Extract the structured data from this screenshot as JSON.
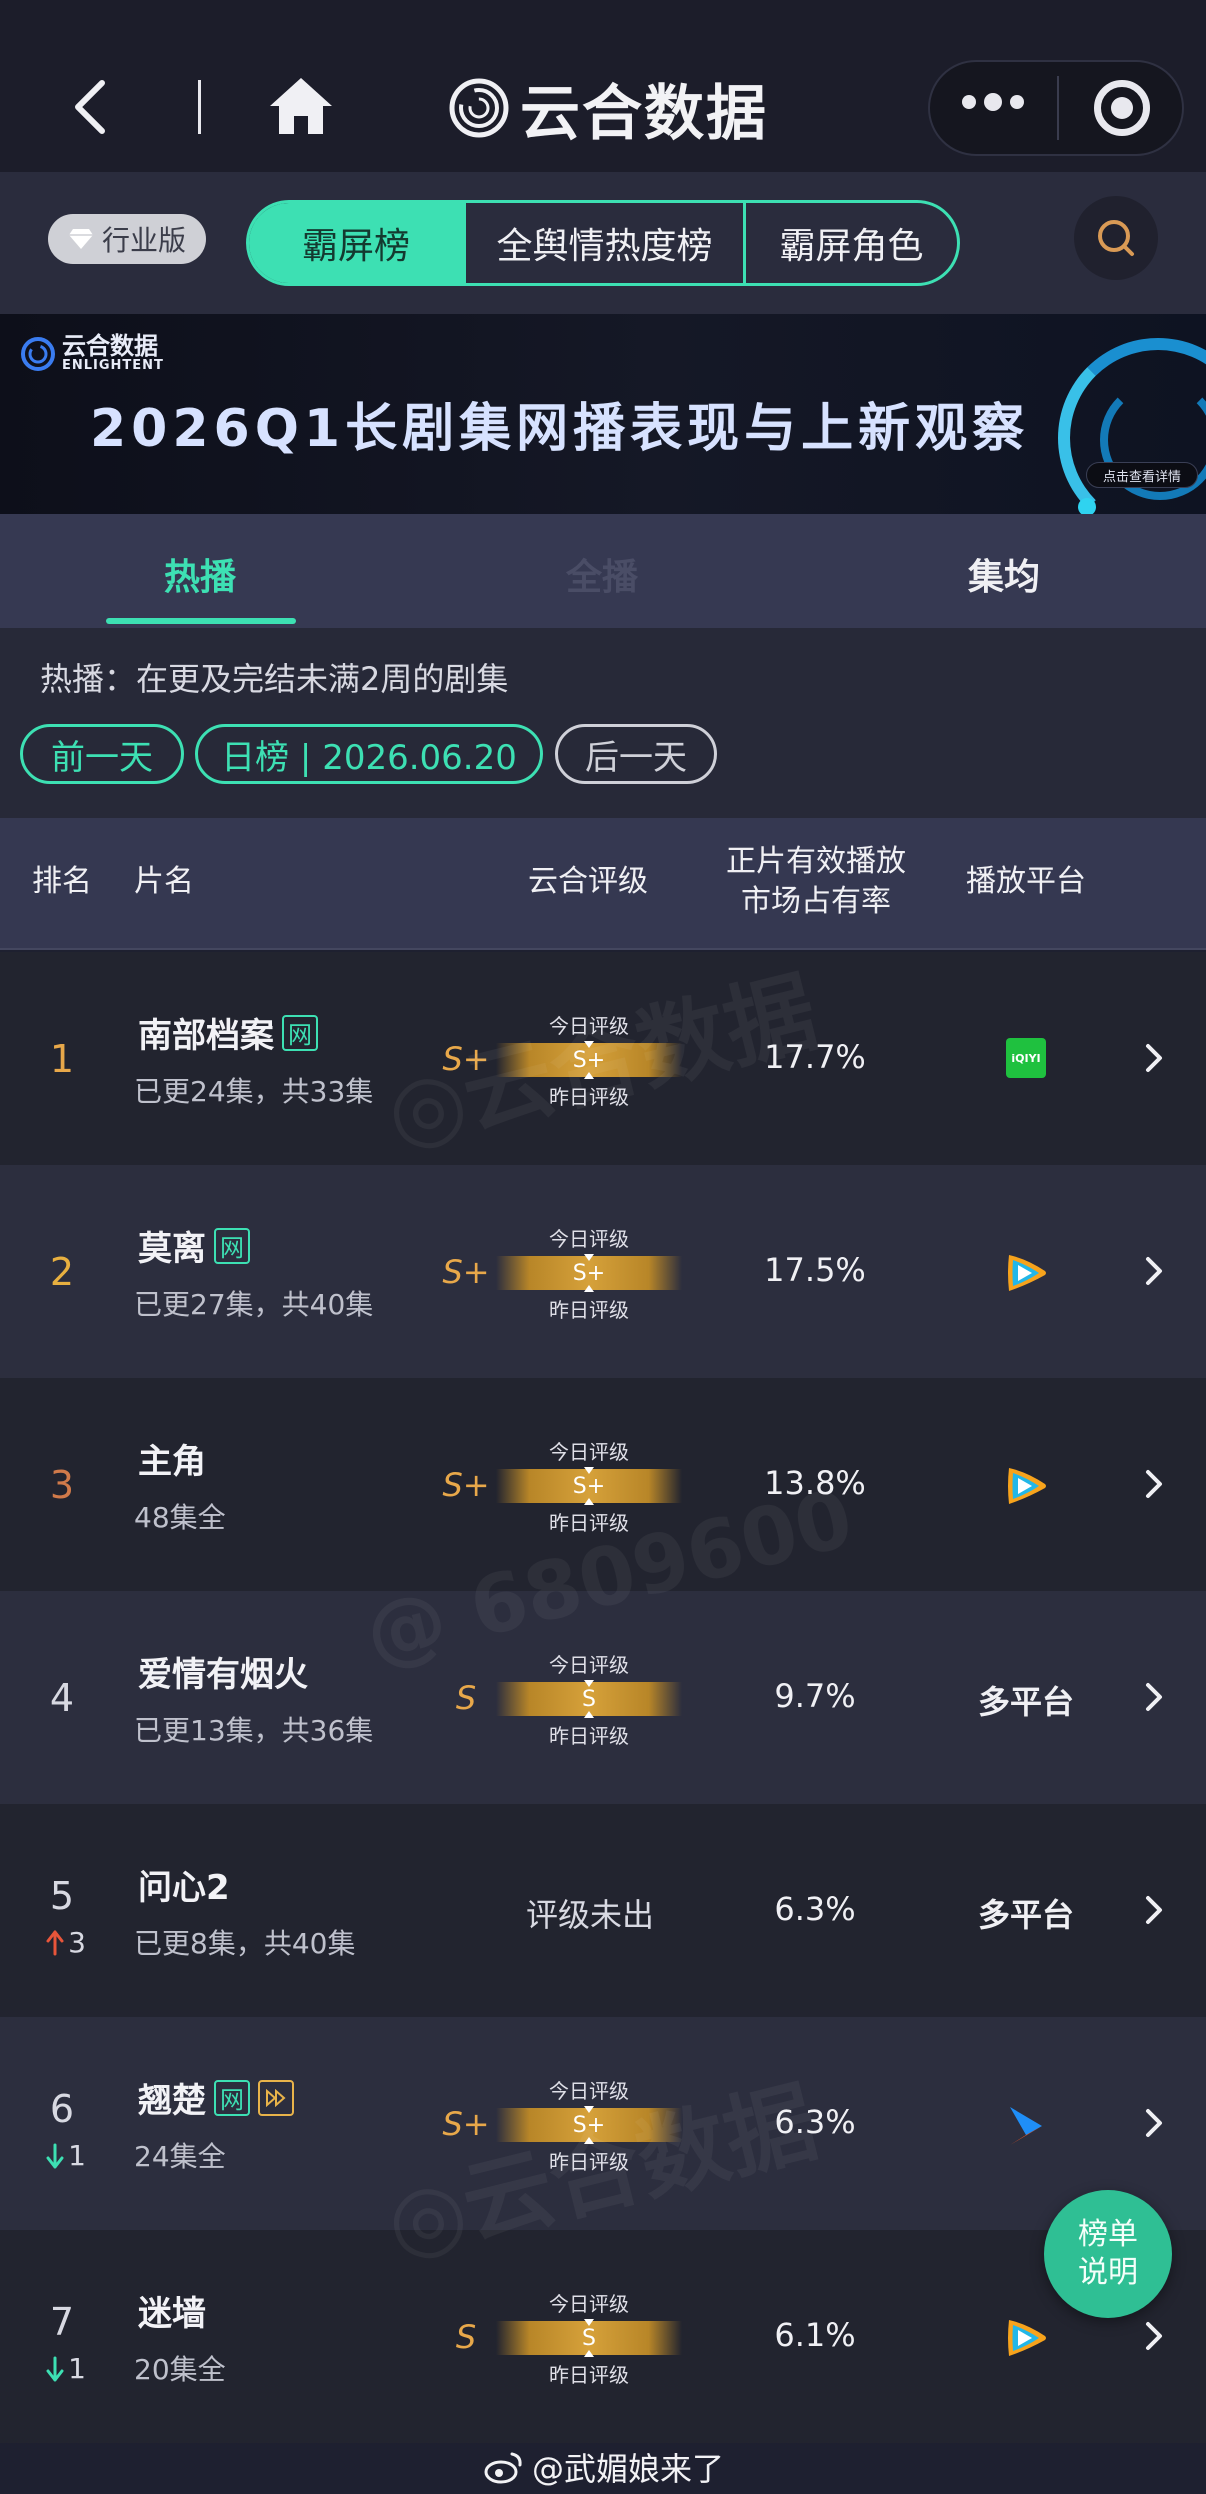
{
  "nav": {
    "brand": "云合数据"
  },
  "filters": {
    "edition": "行业版",
    "segments": [
      "霸屏榜",
      "全舆情热度榜",
      "霸屏角色"
    ]
  },
  "banner": {
    "logo_cn": "云合数据",
    "logo_en": "ENLIGHTENT",
    "title": "2026Q1长剧集网播表现与上新观察",
    "cta": "点击查看详情"
  },
  "tabs": {
    "active": "热播",
    "ghost": "全播",
    "right": "集均"
  },
  "info": {
    "desc": "热播：在更及完结未满2周的剧集",
    "prev": "前一天",
    "date": "日榜 | 2026.06.20",
    "next": "后一天"
  },
  "table_headers": {
    "rank": "排名",
    "name": "片名",
    "grade": "云合评级",
    "share_line1": "正片有效播放",
    "share_line2": "市场占有率",
    "platform": "播放平台"
  },
  "gauge_labels": {
    "today": "今日评级",
    "yesterday": "昨日评级",
    "none": "评级未出"
  },
  "rows": [
    {
      "rank": "1",
      "rank_color": "#e8a84a",
      "trend": "",
      "trend_dir": "",
      "name": "南部档案",
      "badges": [
        "网"
      ],
      "sub": "已更24集，共33集",
      "grade": "S+",
      "grade_bar": "S+",
      "share": "17.7%",
      "platform": "iqiyi",
      "platform_text": "iQIYI"
    },
    {
      "rank": "2",
      "rank_color": "#e8b040",
      "trend": "",
      "trend_dir": "",
      "name": "莫离",
      "badges": [
        "网"
      ],
      "sub": "已更27集，共40集",
      "grade": "S+",
      "grade_bar": "S+",
      "share": "17.5%",
      "platform": "tencent",
      "platform_text": ""
    },
    {
      "rank": "3",
      "rank_color": "#d07a4a",
      "trend": "",
      "trend_dir": "",
      "name": "主角",
      "badges": [],
      "sub": "48集全",
      "grade": "S+",
      "grade_bar": "S+",
      "share": "13.8%",
      "platform": "tencent",
      "platform_text": ""
    },
    {
      "rank": "4",
      "rank_color": "#d8d9e2",
      "trend": "",
      "trend_dir": "",
      "name": "爱情有烟火",
      "badges": [],
      "sub": "已更13集，共36集",
      "grade": "S",
      "grade_bar": "S",
      "share": "9.7%",
      "platform": "multi",
      "platform_text": "多平台"
    },
    {
      "rank": "5",
      "rank_color": "#d8d9e2",
      "trend": "3",
      "trend_dir": "up",
      "name": "问心2",
      "badges": [],
      "sub": "已更8集，共40集",
      "grade": "",
      "grade_bar": "",
      "share": "6.3%",
      "platform": "multi",
      "platform_text": "多平台"
    },
    {
      "rank": "6",
      "rank_color": "#d8d9e2",
      "trend": "1",
      "trend_dir": "down",
      "name": "翘楚",
      "badges": [
        "网",
        "play"
      ],
      "sub": "24集全",
      "grade": "S+",
      "grade_bar": "S+",
      "share": "6.3%",
      "platform": "youku",
      "platform_text": ""
    },
    {
      "rank": "7",
      "rank_color": "#d8d9e2",
      "trend": "1",
      "trend_dir": "down",
      "name": "迷墙",
      "badges": [],
      "sub": "20集全",
      "grade": "S",
      "grade_bar": "S",
      "share": "6.1%",
      "platform": "tencent",
      "platform_text": ""
    }
  ],
  "explain_btn": [
    "榜单",
    "说明"
  ],
  "credit": "@武媚娘来了",
  "colors": {
    "accent": "#3de0b3",
    "grade": "#e8a84a",
    "up": "#e8553a",
    "down": "#3de0b3"
  }
}
